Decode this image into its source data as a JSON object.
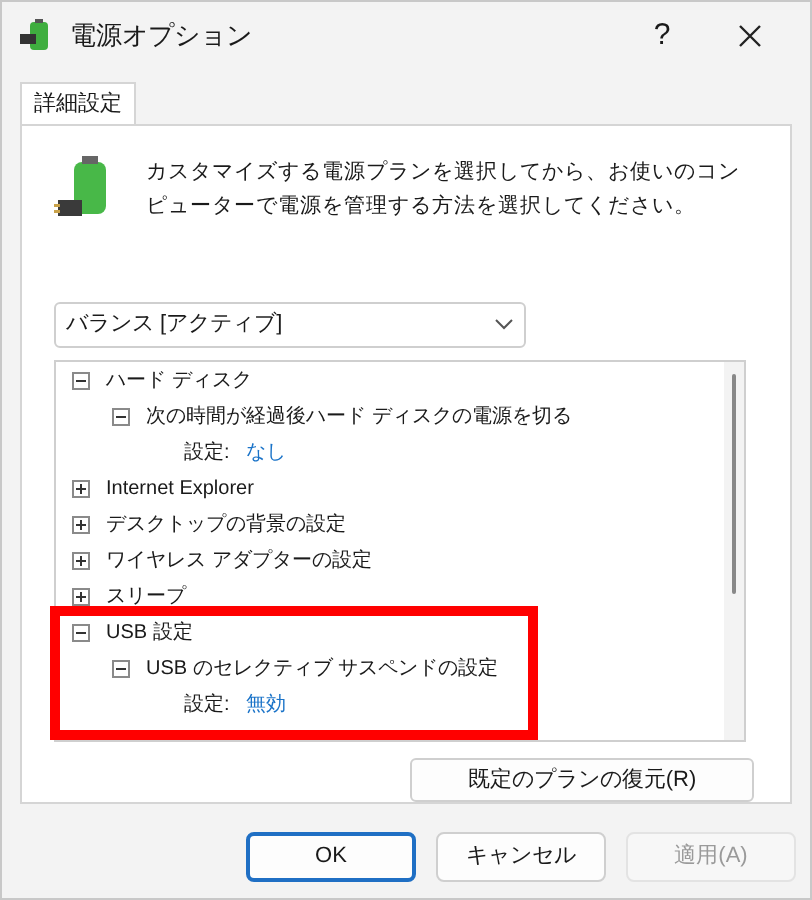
{
  "window": {
    "title": "電源オプション",
    "help": "?"
  },
  "tabs": [
    {
      "label": "詳細設定",
      "selected": true
    }
  ],
  "description": "カスタマイズする電源プランを選択してから、お使いのコンピューターで電源を管理する方法を選択してください。",
  "plan_select": {
    "value": "バランス [アクティブ]"
  },
  "tree": [
    {
      "label": "ハード ディスク",
      "expanded": true,
      "children": [
        {
          "label": "次の時間が経過後ハード ディスクの電源を切る",
          "expanded": true,
          "setting": {
            "label": "設定:",
            "value": "なし"
          }
        }
      ]
    },
    {
      "label": "Internet Explorer",
      "expanded": false
    },
    {
      "label": "デスクトップの背景の設定",
      "expanded": false
    },
    {
      "label": "ワイヤレス アダプターの設定",
      "expanded": false
    },
    {
      "label": "スリープ",
      "expanded": false
    },
    {
      "label": "USB 設定",
      "expanded": true,
      "children": [
        {
          "label": "USB のセレクティブ サスペンドの設定",
          "expanded": true,
          "setting": {
            "label": "設定:",
            "value": "無効"
          }
        }
      ]
    }
  ],
  "restore_button": "既定のプランの復元(R)",
  "buttons": [
    {
      "label": "OK",
      "kind": "default",
      "disabled": false
    },
    {
      "label": "キャンセル",
      "kind": "normal",
      "disabled": false
    },
    {
      "label": "適用(A)",
      "kind": "normal",
      "disabled": true
    }
  ]
}
